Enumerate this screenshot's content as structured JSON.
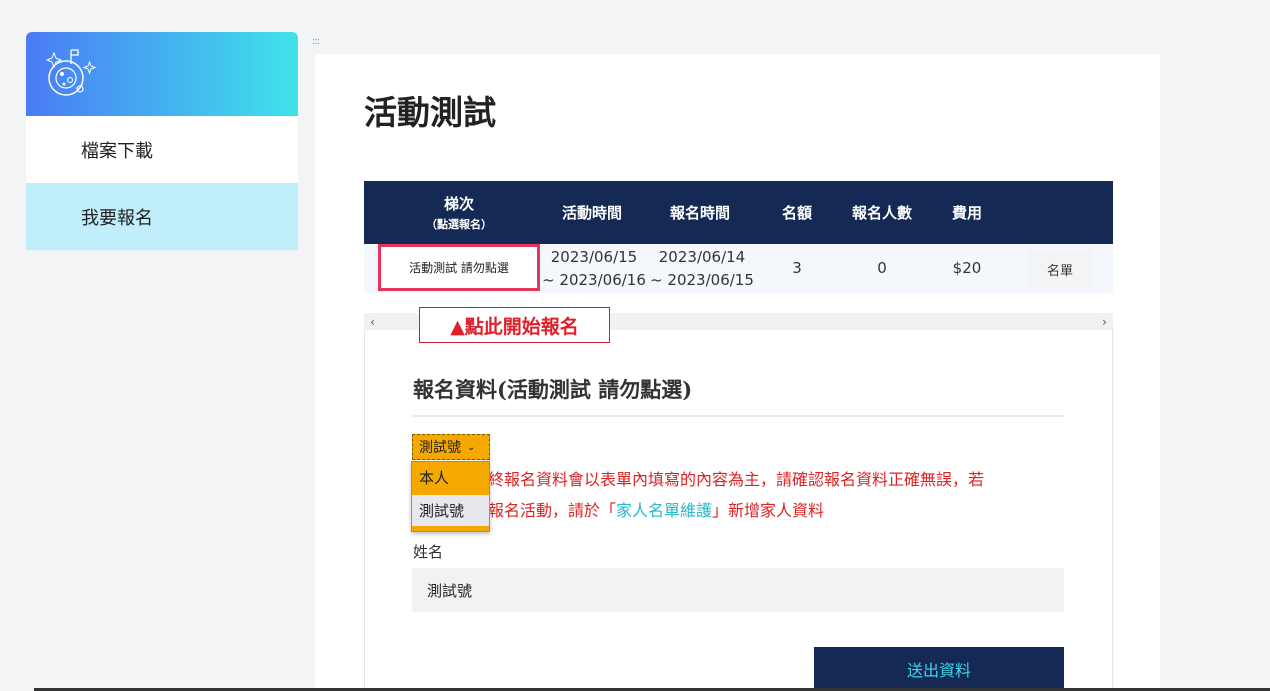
{
  "sidebar": {
    "logo_icon": "planet-sparkle-icon",
    "items": [
      {
        "label": "檔案下載"
      },
      {
        "label": "我要報名"
      }
    ]
  },
  "main": {
    "title": "活動測試",
    "table": {
      "headers": [
        "梯次",
        "（點選報名）",
        "活動時間",
        "報名時間",
        "名額",
        "報名人數",
        "費用"
      ],
      "row": {
        "session": "活動測試 請勿點選",
        "event_start": "2023/06/15",
        "event_end": "~ 2023/06/16",
        "signup_start": "2023/06/14",
        "signup_end": "~ 2023/06/15",
        "quota": "3",
        "registered": "0",
        "fee": "$20",
        "list_button": "名單"
      }
    },
    "callout": "▲點此開始報名",
    "form": {
      "title": "報名資料(活動測試 請勿點選)",
      "select_value": "測試號",
      "options": [
        "本人",
        "測試號"
      ],
      "notice_part1": "終報名資料會以表單內填寫的內容為主，請確認報名資料正確無誤，若",
      "notice_part2": "報名活動，請於「",
      "notice_link": "家人名單維護",
      "notice_part3": "」新增家人資料",
      "name_label": "姓名",
      "name_value": "測試號",
      "submit_label": "送出資料"
    }
  },
  "colors": {
    "table_header": "#142a55",
    "highlight_border": "#e2375a",
    "dropdown": "#f5a800",
    "notice_red": "#dd2222",
    "link_cyan": "#24b8c8",
    "sidebar_active": "#c0eefb"
  }
}
